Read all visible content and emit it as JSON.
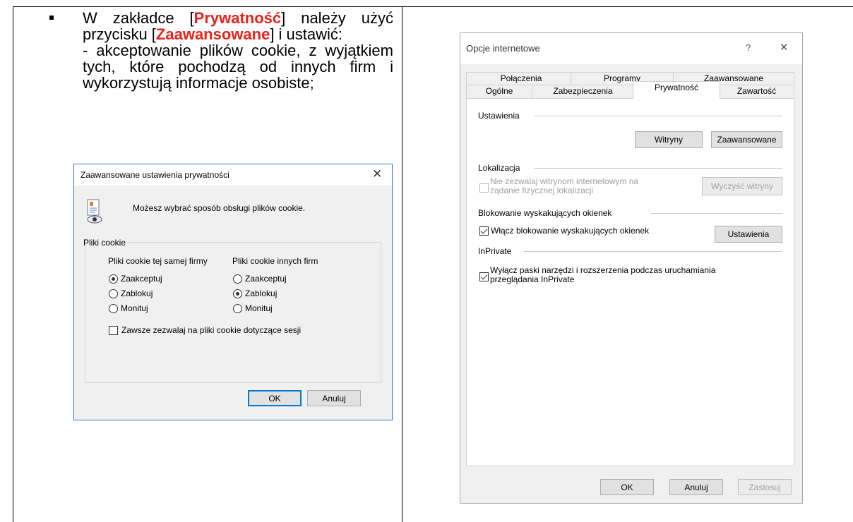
{
  "instructions": {
    "part1": "W zakładce [",
    "tab_name": "Prywatność",
    "part2": "] należy użyć przycisku [",
    "button_name": "Zaawansowane",
    "part3": "] i ustawić:",
    "line2": "- akceptowanie plików cookie, z wyjątkiem tych, które pochodzą od innych firm i wykorzystują informacje osobiste;"
  },
  "privacy_dialog": {
    "title": "Zaawansowane ustawienia prywatności",
    "message": "Możesz wybrać sposób obsługi plików cookie.",
    "group_label": "Pliki cookie",
    "first_party_header": "Pliki cookie tej samej firmy",
    "third_party_header": "Pliki cookie innych firm",
    "first_party_options": [
      "Zaakceptuj",
      "Zablokuj",
      "Monituj"
    ],
    "first_party_selected": 0,
    "third_party_options": [
      "Zaakceptuj",
      "Zablokuj",
      "Monituj"
    ],
    "third_party_selected": 1,
    "session_checkbox": "Zawsze zezwalaj na pliki cookie dotyczące sesji",
    "session_checked": false,
    "ok_label": "OK",
    "cancel_label": "Anuluj",
    "accent": "#0078d7"
  },
  "internet_options": {
    "title": "Opcje internetowe",
    "help_glyph": "?",
    "close_glyph": "✕",
    "tabs_row1": [
      "Połączenia",
      "Programy",
      "Zaawansowane"
    ],
    "tabs_row2": [
      "Ogólne",
      "Zabezpieczenia",
      "Prywatność",
      "Zawartość"
    ],
    "active_tab": "Prywatność",
    "settings_section": "Ustawienia",
    "sites_button": "Witryny",
    "advanced_button": "Zaawansowane",
    "location_section": "Lokalizacja",
    "location_checkbox": "Nie zezwalaj witrynom internetowym na żądanie fizycznej lokalizacji",
    "clear_sites_button": "Wyczyść witryny",
    "popup_section": "Blokowanie wyskakujących okienek",
    "popup_checkbox": "Włącz blokowanie wyskakujących okienek",
    "popup_settings_button": "Ustawienia",
    "inprivate_section": "InPrivate",
    "inprivate_checkbox": "Wyłącz paski narzędzi i rozszerzenia podczas uruchamiania przeglądania InPrivate",
    "ok_label": "OK",
    "cancel_label": "Anuluj",
    "apply_label": "Zastosuj"
  }
}
